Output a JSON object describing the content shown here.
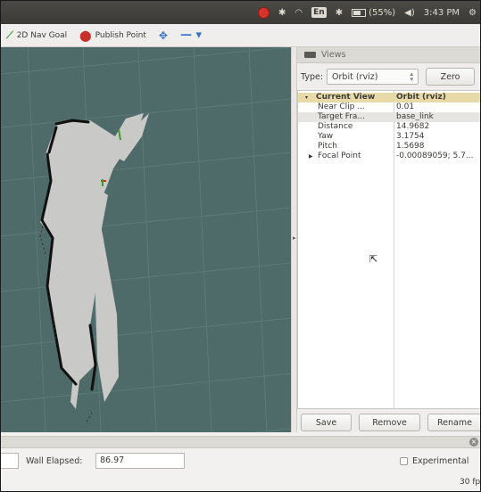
{
  "system_panel": {
    "keyboard_layout": "En",
    "battery": "(55%)",
    "clock": "3:43 PM"
  },
  "toolbar": {
    "tools": [
      {
        "label": "2D Nav Goal",
        "icon": "green-arrow-icon"
      },
      {
        "label": "Publish Point",
        "icon": "map-pin-icon"
      },
      {
        "label": "",
        "icon": "move-camera-icon"
      },
      {
        "label": "",
        "icon": "minus-dropdown-icon"
      }
    ]
  },
  "views": {
    "panel_title": "Views",
    "type_label": "Type:",
    "type_value": "Orbit (rviz)",
    "zero_label": "Zero",
    "current_view": {
      "name": "Current View",
      "value": "Orbit (rviz)"
    },
    "properties": [
      {
        "name": "Near Clip ...",
        "value": "0.01"
      },
      {
        "name": "Target Fra...",
        "value": "base_link"
      },
      {
        "name": "Distance",
        "value": "14.9682"
      },
      {
        "name": "Yaw",
        "value": "3.1754"
      },
      {
        "name": "Pitch",
        "value": "1.5698"
      },
      {
        "name": "Focal Point",
        "value": "-0.00089059; 5.7..."
      }
    ],
    "buttons": {
      "save": "Save",
      "remove": "Remove",
      "rename": "Rename"
    }
  },
  "time_panel": {
    "wall_elapsed_label": "Wall Elapsed:",
    "wall_elapsed_value": "86.97",
    "experimental_label": "Experimental",
    "fps": "30 fp"
  },
  "colors": {
    "viewport_bg": "#4f6b69",
    "map_free": "#c9c9c7",
    "map_wall": "#111111",
    "header_highlight": "#e7d9a8"
  }
}
